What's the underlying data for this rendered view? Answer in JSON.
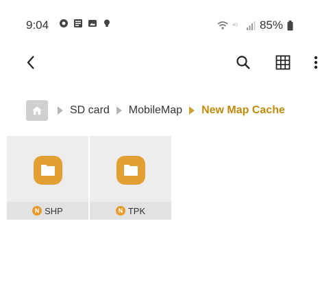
{
  "status_bar": {
    "time": "9:04",
    "left_icons": [
      "messenger-icon",
      "news-icon",
      "gallery-icon",
      "bulb-icon"
    ],
    "battery_text": "85%",
    "right_icons": [
      "wifi-icon",
      "lte-icon",
      "signal-icon",
      "battery-icon"
    ]
  },
  "toolbar": {
    "back_icon": "chevron-left-icon",
    "search_icon": "search-icon",
    "grid_icon": "grid-view-icon",
    "more_icon": "more-vertical-icon"
  },
  "breadcrumb": {
    "items": [
      "SD card",
      "MobileMap",
      "New Map Cache"
    ]
  },
  "folders": [
    {
      "name": "SHP",
      "badge": "N"
    },
    {
      "name": "TPK",
      "badge": "N"
    }
  ],
  "colors": {
    "accent": "#c08a0d",
    "folder": "#e2a033",
    "tile_bg": "#ededed"
  }
}
